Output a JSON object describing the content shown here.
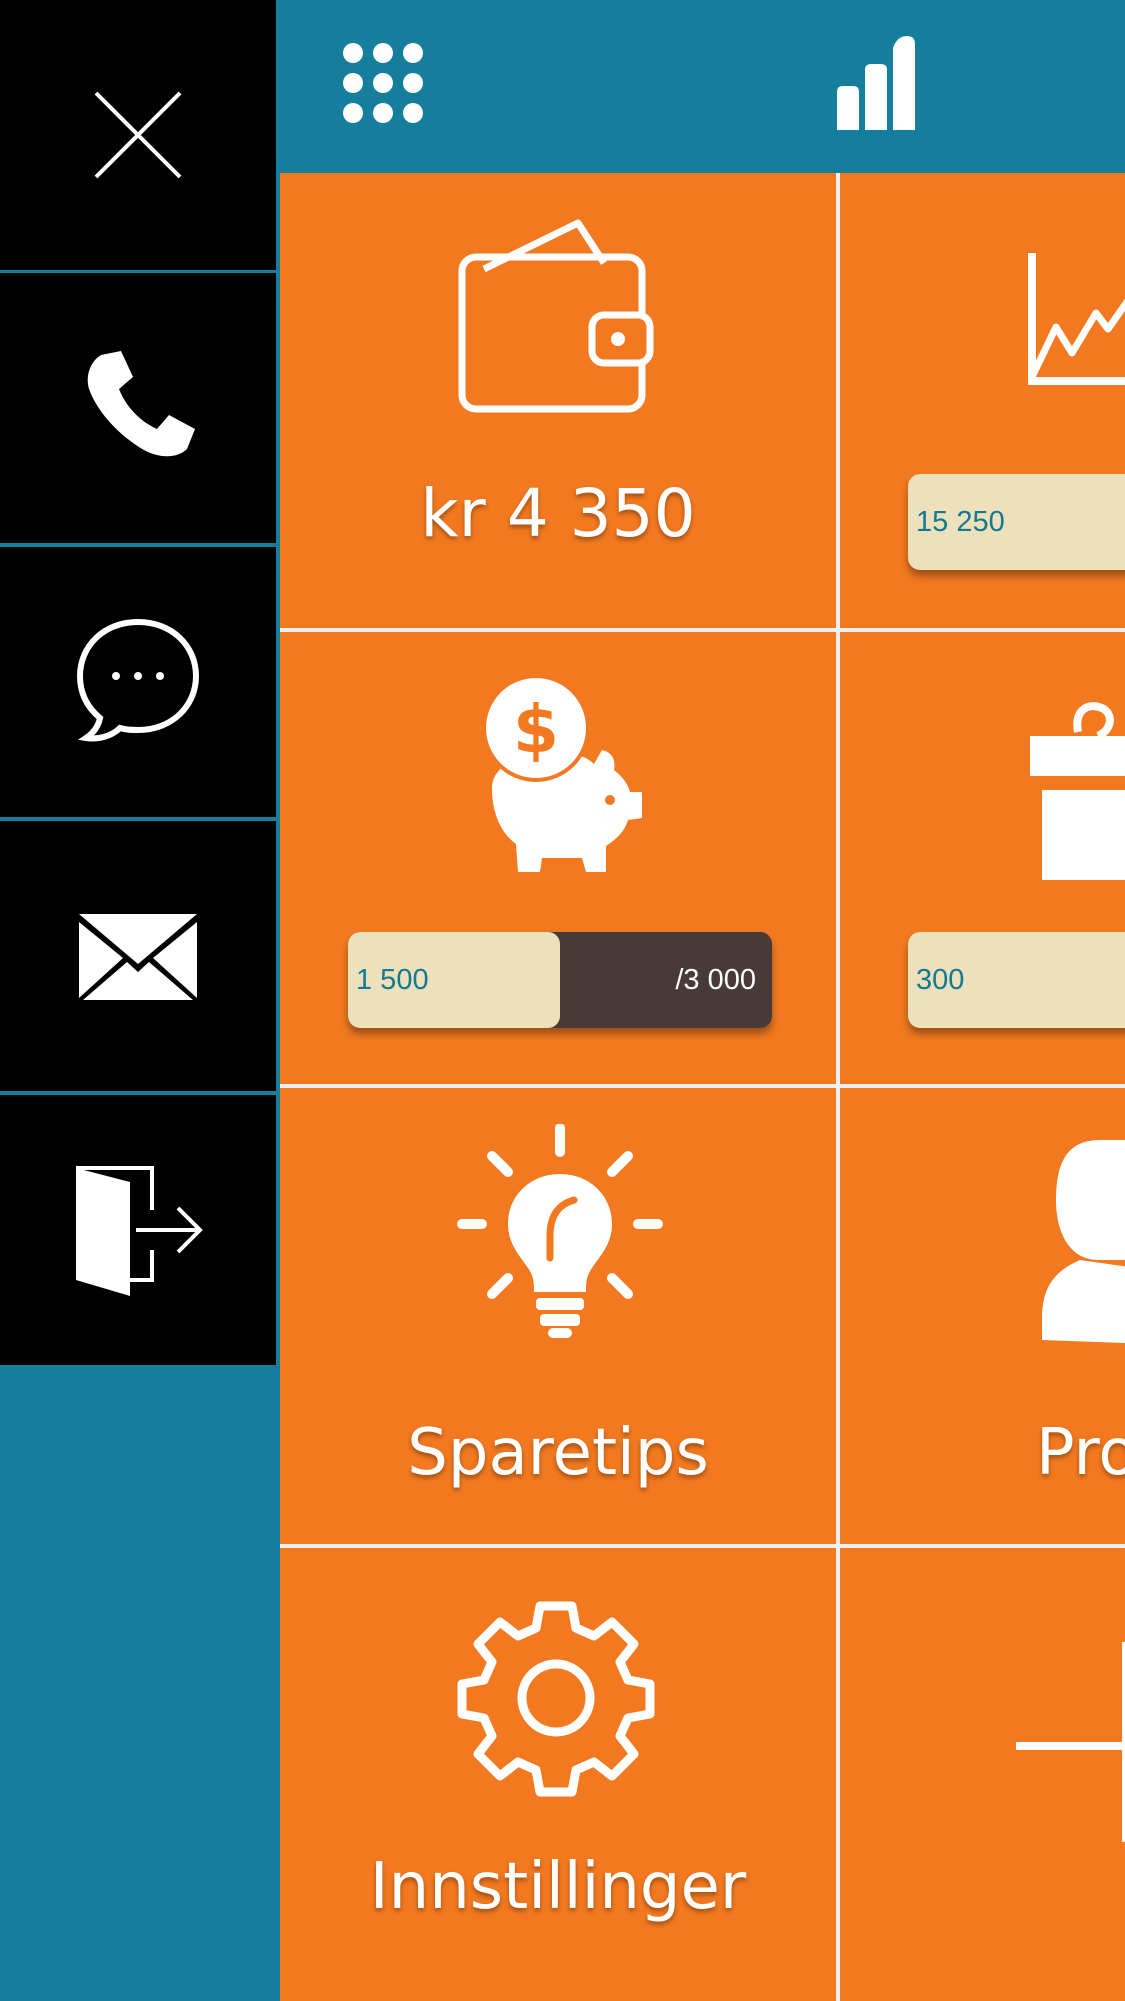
{
  "sidebar": {
    "items": [
      {
        "icon": "close-icon"
      },
      {
        "icon": "phone-icon"
      },
      {
        "icon": "chat-icon"
      },
      {
        "icon": "mail-icon"
      },
      {
        "icon": "logout-icon"
      }
    ]
  },
  "topbar": {
    "left_icon": "apps-grid-icon",
    "right_icon": "bar-chart-icon"
  },
  "tiles": {
    "wallet": {
      "label": "kr 4 350",
      "icon": "wallet-icon"
    },
    "investments": {
      "icon": "line-chart-icon",
      "progress_current": "15 250"
    },
    "savings": {
      "icon": "piggy-bank-icon",
      "progress_current": "1 500",
      "progress_max": "/3 000",
      "progress_fraction": 0.5
    },
    "gifts": {
      "icon": "gift-icon",
      "progress_current": "300"
    },
    "tips": {
      "label": "Sparetips",
      "icon": "lightbulb-icon"
    },
    "profile": {
      "label": "Pro",
      "icon": "person-icon"
    },
    "settings": {
      "label": "Innstillinger",
      "icon": "gear-icon"
    },
    "add": {
      "icon": "plus-icon"
    }
  },
  "colors": {
    "accent_orange": "#f27920",
    "teal": "#147e9c",
    "black": "#000000",
    "pill_fill": "#ede0bd",
    "pill_track": "#473a39"
  }
}
